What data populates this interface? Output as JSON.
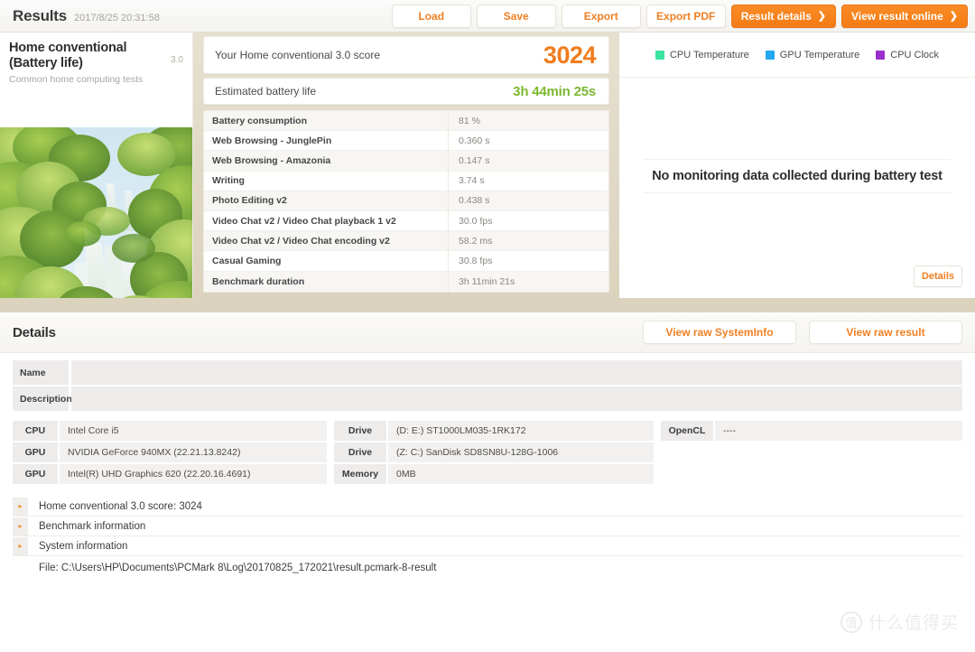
{
  "topbar": {
    "title": "Results",
    "timestamp": "2017/8/25 20:31:58",
    "buttons": [
      {
        "label": "Load",
        "style": "light"
      },
      {
        "label": "Save",
        "style": "light"
      },
      {
        "label": "Export",
        "style": "light"
      },
      {
        "label": "Export PDF",
        "style": "light"
      },
      {
        "label": "Result details",
        "style": "primary",
        "chevron": "❯"
      },
      {
        "label": "View result online",
        "style": "primary",
        "chevron": "❯"
      }
    ]
  },
  "test_card": {
    "name": "Home conventional (Battery life)",
    "subtitle": "Common home computing tests",
    "version": "3.0",
    "thumbnail_alt": "waterfall-jungle-photo"
  },
  "score_panel": {
    "score_label": "Your Home conventional 3.0 score",
    "score_value": "3024",
    "battery_label": "Estimated battery life",
    "battery_value": "3h 44min 25s",
    "metrics": [
      {
        "name": "Battery consumption",
        "value": "81 %"
      },
      {
        "name": "Web Browsing - JunglePin",
        "value": "0.360 s"
      },
      {
        "name": "Web Browsing - Amazonia",
        "value": "0.147 s"
      },
      {
        "name": "Writing",
        "value": "3.74 s"
      },
      {
        "name": "Photo Editing v2",
        "value": "0.438 s"
      },
      {
        "name": "Video Chat v2 / Video Chat playback 1 v2",
        "value": "30.0 fps"
      },
      {
        "name": "Video Chat v2 / Video Chat encoding v2",
        "value": "58.2 ms"
      },
      {
        "name": "Casual Gaming",
        "value": "30.8 fps"
      },
      {
        "name": "Benchmark duration",
        "value": "3h 11min 21s"
      }
    ]
  },
  "monitor_panel": {
    "legend": [
      {
        "label": "CPU Temperature",
        "color": "#3ae3a0"
      },
      {
        "label": "GPU Temperature",
        "color": "#21a8ef"
      },
      {
        "label": "CPU Clock",
        "color": "#9b2fce"
      }
    ],
    "empty_message": "No monitoring data collected during battery test",
    "details_button": "Details"
  },
  "details": {
    "title": "Details",
    "raw_buttons": [
      {
        "label": "View raw SystemInfo"
      },
      {
        "label": "View raw result"
      }
    ],
    "meta": [
      {
        "key": "Name",
        "value": ""
      },
      {
        "key": "Description",
        "value": ""
      }
    ],
    "hardware": {
      "column1": [
        {
          "key": "CPU",
          "value": "Intel Core i5"
        },
        {
          "key": "GPU",
          "value": "NVIDIA GeForce 940MX (22.21.13.8242)"
        },
        {
          "key": "GPU",
          "value": "Intel(R) UHD Graphics 620 (22.20.16.4691)"
        }
      ],
      "column2": [
        {
          "key": "Drive",
          "value": "(D: E:) ST1000LM035-1RK172"
        },
        {
          "key": "Drive",
          "value": "(Z: C:) SanDisk SD8SN8U-128G-1006"
        },
        {
          "key": "Memory",
          "value": "0MB"
        }
      ],
      "column3": [
        {
          "key": "OpenCL",
          "value": "----"
        }
      ]
    },
    "expanders": [
      {
        "label": "Home conventional 3.0 score: 3024",
        "caret": "▸"
      },
      {
        "label": "Benchmark information",
        "caret": "▸"
      },
      {
        "label": "System information",
        "caret": "▸"
      }
    ],
    "file_line": "File: C:\\Users\\HP\\Documents\\PCMark 8\\Log\\20170825_172021\\result.pcmark-8-result"
  },
  "watermark": {
    "badge": "值",
    "text": "什么值得买"
  }
}
